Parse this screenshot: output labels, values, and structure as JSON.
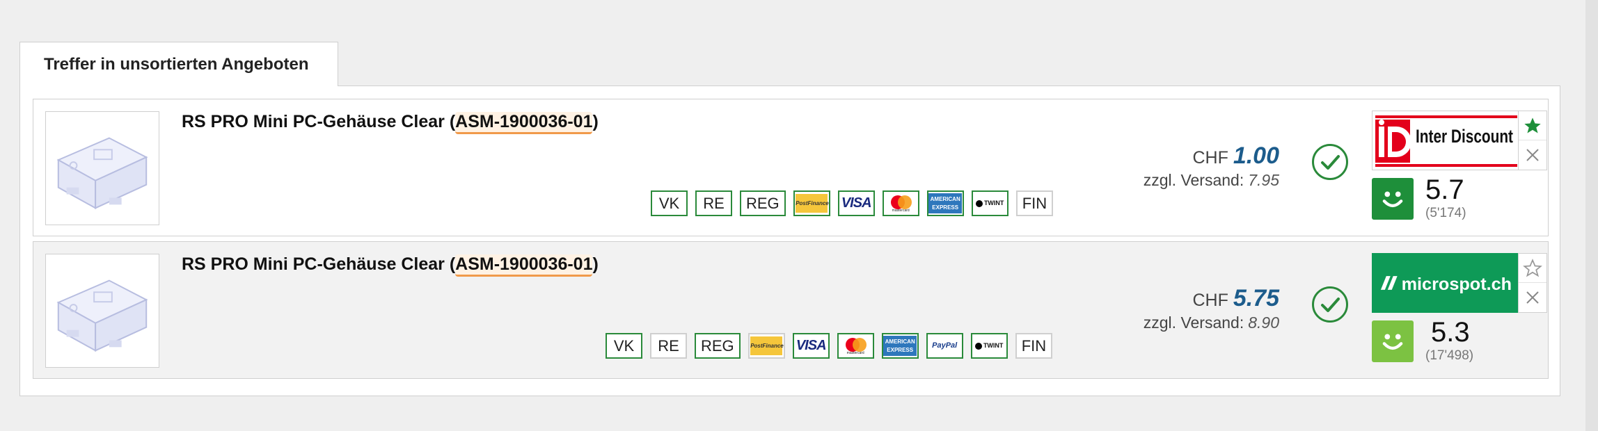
{
  "tab": {
    "label": "Treffer in unsortierten Angeboten"
  },
  "offers": [
    {
      "title_prefix": "RS PRO Mini PC-Gehäuse Clear (",
      "code": "ASM-1900036-01",
      "title_suffix": ")",
      "payments": [
        "VK",
        "RE",
        "REG",
        "PostFinance",
        "VISA",
        "mastercard",
        "AMERICAN EXPRESS",
        "TWINT",
        "FIN"
      ],
      "currency": "CHF",
      "price": "1.00",
      "shipping_label": "zzgl. Versand:",
      "shipping": "7.95",
      "shop": "Inter Discount",
      "rating": "5.7",
      "rating_count": "(5'174)",
      "favorite": true,
      "face_color": "#1e8f3a"
    },
    {
      "title_prefix": "RS PRO Mini PC-Gehäuse Clear (",
      "code": "ASM-1900036-01",
      "title_suffix": ")",
      "payments": [
        "VK",
        "RE",
        "REG",
        "PostFinance",
        "VISA",
        "mastercard",
        "AMERICAN EXPRESS",
        "PayPal",
        "TWINT",
        "FIN"
      ],
      "currency": "CHF",
      "price": "5.75",
      "shipping_label": "zzgl. Versand:",
      "shipping": "8.90",
      "shop": "microspot.ch",
      "rating": "5.3",
      "rating_count": "(17'498)",
      "favorite": false,
      "face_color": "#7cc242"
    }
  ],
  "colors": {
    "accent_green": "#2a8a3a",
    "price_blue": "#1c5c8c",
    "code_underline": "#f19a4a",
    "interdiscount_red": "#e3001b",
    "microspot_green": "#0e9a57"
  },
  "icons": [
    "check-circle-icon",
    "star-filled-icon",
    "star-outline-icon",
    "close-icon",
    "smiley-icon"
  ]
}
